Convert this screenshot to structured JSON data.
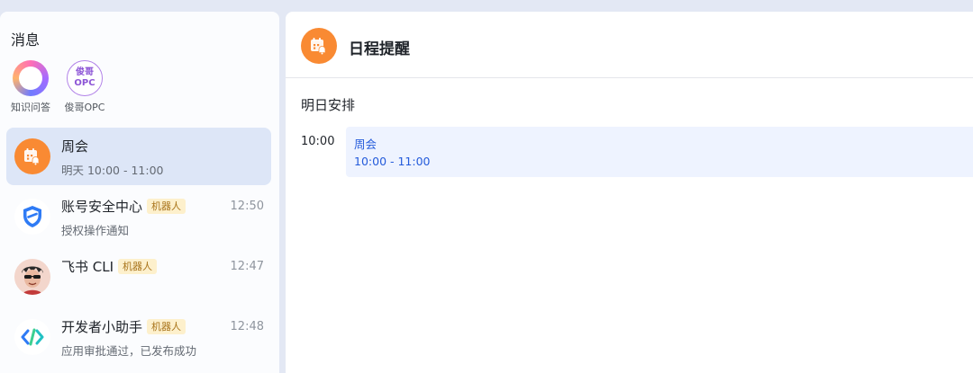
{
  "sidebar": {
    "title": "消息",
    "quick_apps": [
      {
        "label": "知识问答",
        "icon": "knowledge-qa-ring-icon"
      },
      {
        "label": "俊哥OPC",
        "icon_text_top": "俊哥",
        "icon_text_bottom": "OPC"
      }
    ],
    "chats": [
      {
        "name": "周会",
        "preview": "明天 10:00 - 11:00",
        "time": "",
        "badge": "",
        "icon": "calendar-bell-icon",
        "active": true
      },
      {
        "name": "账号安全中心",
        "badge": "机器人",
        "time": "12:50",
        "preview": "授权操作通知",
        "icon": "shield-check-icon"
      },
      {
        "name": "飞书 CLI",
        "badge": "机器人",
        "time": "12:47",
        "preview": "",
        "icon": "cartoon-person-avatar"
      },
      {
        "name": "开发者小助手",
        "badge": "机器人",
        "time": "12:48",
        "preview": "应用审批通过，已发布成功",
        "icon": "code-brackets-icon"
      }
    ]
  },
  "detail": {
    "title": "日程提醒",
    "section_title": "明日安排",
    "slot_time": "10:00",
    "event": {
      "name": "周会",
      "time_range": "10:00 - 11:00"
    }
  },
  "colors": {
    "accent_orange": "#f98a33",
    "active_row": "#dde6f7",
    "event_bg": "#eef3ff",
    "event_text": "#245bdb",
    "badge_bg": "#fdf0cc",
    "badge_text": "#a8731a"
  }
}
